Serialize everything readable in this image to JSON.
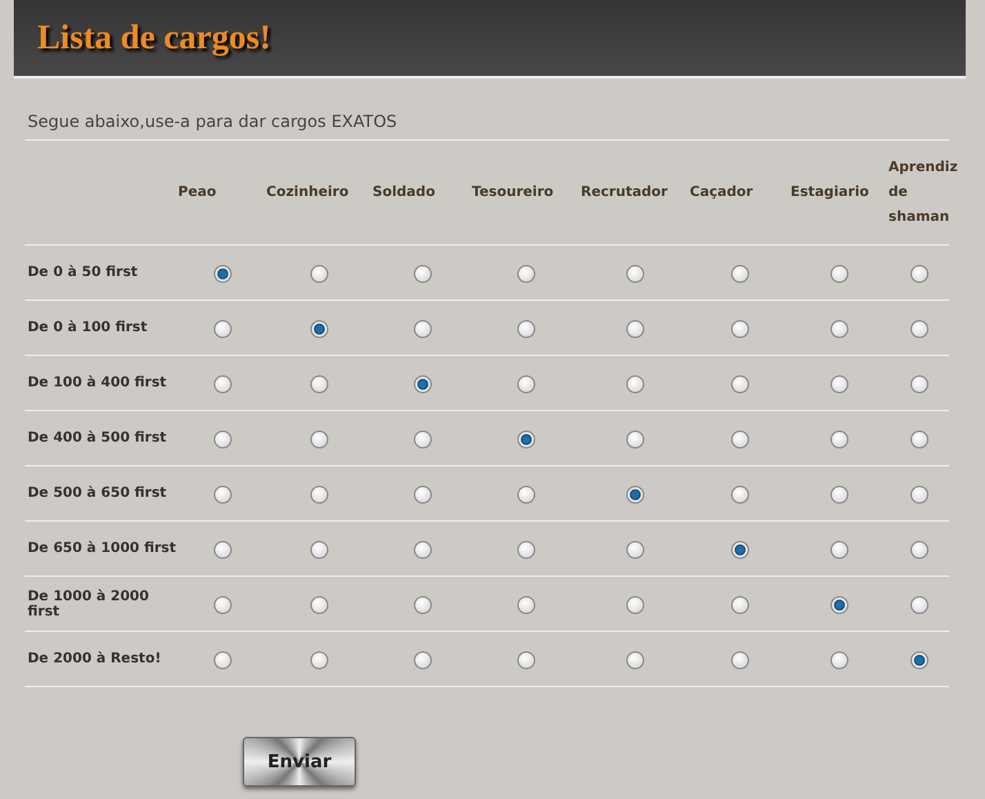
{
  "header": {
    "title": "Lista de cargos!"
  },
  "intro": "Segue abaixo,use-a para dar cargos EXATOS",
  "table": {
    "columns": [
      "Peao",
      "Cozinheiro",
      "Soldado",
      "Tesoureiro",
      "Recrutador",
      "Caçador",
      "Estagiario",
      "Aprendiz de shaman"
    ],
    "rows": [
      {
        "label": "De 0 à 50 first",
        "options": [
          {
            "selected": true
          },
          {
            "selected": false
          },
          {
            "selected": false
          },
          {
            "selected": false
          },
          {
            "selected": false
          },
          {
            "selected": false
          },
          {
            "selected": false
          },
          {
            "selected": false
          }
        ]
      },
      {
        "label": "De 0 à 100 first",
        "options": [
          {
            "selected": false
          },
          {
            "selected": true
          },
          {
            "selected": false
          },
          {
            "selected": false
          },
          {
            "selected": false
          },
          {
            "selected": false
          },
          {
            "selected": false
          },
          {
            "selected": false
          }
        ]
      },
      {
        "label": "De 100 à 400 first",
        "options": [
          {
            "selected": false
          },
          {
            "selected": false
          },
          {
            "selected": true
          },
          {
            "selected": false
          },
          {
            "selected": false
          },
          {
            "selected": false
          },
          {
            "selected": false
          },
          {
            "selected": false
          }
        ]
      },
      {
        "label": "De 400 à 500 first",
        "options": [
          {
            "selected": false
          },
          {
            "selected": false
          },
          {
            "selected": false
          },
          {
            "selected": true
          },
          {
            "selected": false
          },
          {
            "selected": false
          },
          {
            "selected": false
          },
          {
            "selected": false
          }
        ]
      },
      {
        "label": "De 500 à 650 first",
        "options": [
          {
            "selected": false
          },
          {
            "selected": false
          },
          {
            "selected": false
          },
          {
            "selected": false
          },
          {
            "selected": true
          },
          {
            "selected": false
          },
          {
            "selected": false
          },
          {
            "selected": false
          }
        ]
      },
      {
        "label": "De 650 à 1000 first",
        "options": [
          {
            "selected": false
          },
          {
            "selected": false
          },
          {
            "selected": false
          },
          {
            "selected": false
          },
          {
            "selected": false
          },
          {
            "selected": true
          },
          {
            "selected": false
          },
          {
            "selected": false
          }
        ]
      },
      {
        "label": "De 1000 à 2000 first",
        "options": [
          {
            "selected": false
          },
          {
            "selected": false
          },
          {
            "selected": false
          },
          {
            "selected": false
          },
          {
            "selected": false
          },
          {
            "selected": false
          },
          {
            "selected": true
          },
          {
            "selected": false
          }
        ]
      },
      {
        "label": "De 2000 à Resto!",
        "options": [
          {
            "selected": false
          },
          {
            "selected": false
          },
          {
            "selected": false
          },
          {
            "selected": false
          },
          {
            "selected": false
          },
          {
            "selected": false
          },
          {
            "selected": false
          },
          {
            "selected": true
          }
        ]
      }
    ]
  },
  "submit": "Enviar"
}
